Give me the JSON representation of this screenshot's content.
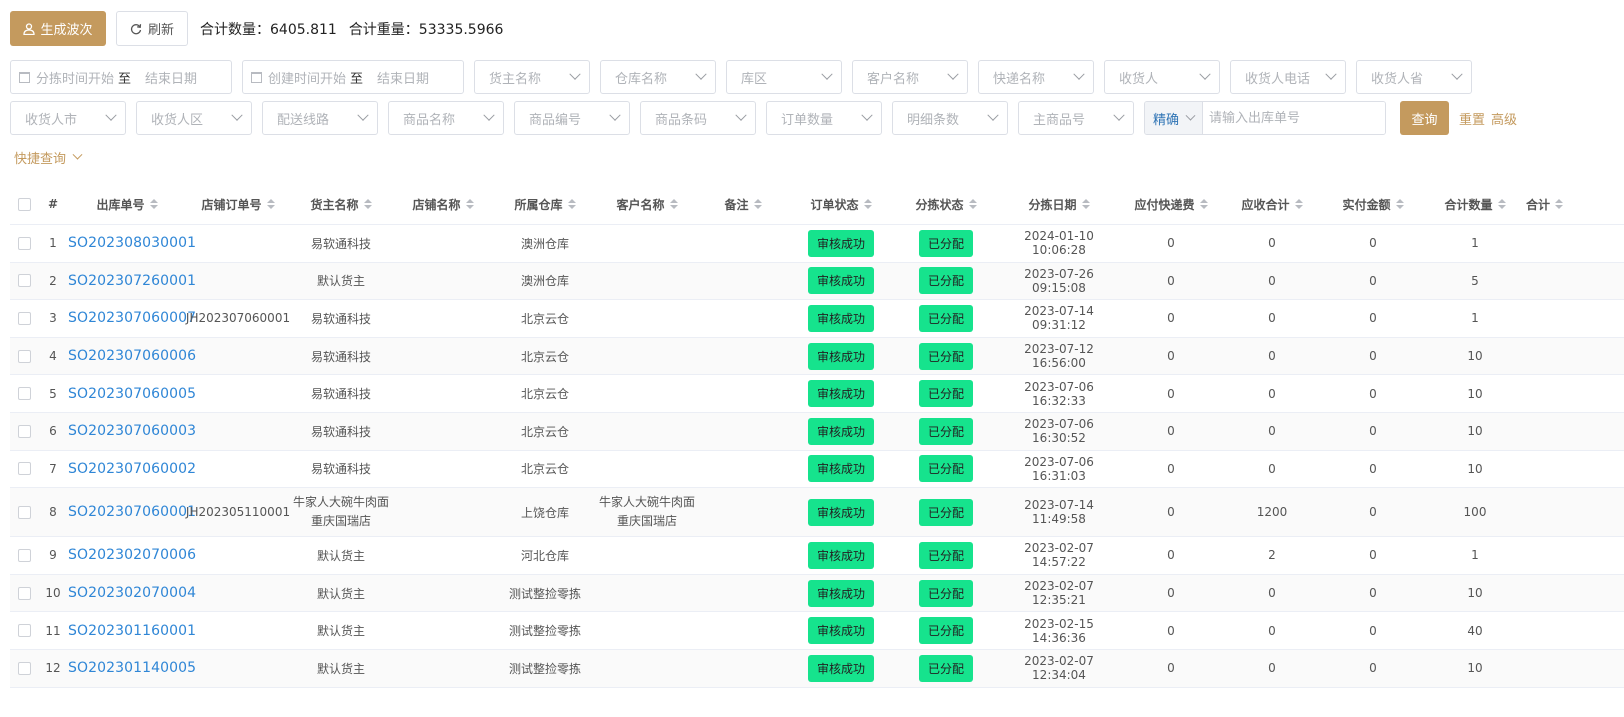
{
  "toolbar": {
    "generate_label": "生成波次",
    "refresh_label": "刷新",
    "total_qty": "合计数量：6405.811",
    "total_weight": "合计重量：53335.5966"
  },
  "filters": {
    "sort_time": {
      "start": "分拣时间开始",
      "sep": "至",
      "end": "结束日期"
    },
    "create_time": {
      "start": "创建时间开始",
      "sep": "至",
      "end": "结束日期"
    },
    "row1": [
      "货主名称",
      "仓库名称",
      "库区",
      "客户名称",
      "快递名称",
      "收货人",
      "收货人电话",
      "收货人省"
    ],
    "row2": [
      "收货人市",
      "收货人区",
      "配送线路",
      "商品名称",
      "商品编号",
      "商品条码",
      "订单数量",
      "明细条数",
      "主商品号"
    ],
    "search_mode": "精确",
    "search_placeholder": "请输入出库单号",
    "query_label": "查询",
    "reset_label": "重置",
    "advanced_label": "高级",
    "quick_query_label": "快捷查询"
  },
  "table": {
    "headers": [
      "#",
      "出库单号",
      "店铺订单号",
      "货主名称",
      "店铺名称",
      "所属仓库",
      "客户名称",
      "备注",
      "订单状态",
      "分拣状态",
      "分拣日期",
      "应付快递费",
      "应收合计",
      "实付金额",
      "合计数量",
      "合计"
    ],
    "rows": [
      {
        "idx": "1",
        "so": "SO202308030001",
        "shop_order": "",
        "owner": "易软通科技",
        "shop": "",
        "warehouse": "澳洲仓库",
        "customer": "",
        "remark": "",
        "order_status": "审核成功",
        "sort_status": "已分配",
        "sort_date": "2024-01-10 10:06:28",
        "freight": "0",
        "receivable": "0",
        "paid": "0",
        "qty": "1"
      },
      {
        "idx": "2",
        "so": "SO202307260001",
        "shop_order": "",
        "owner": "默认货主",
        "shop": "",
        "warehouse": "澳洲仓库",
        "customer": "",
        "remark": "",
        "order_status": "审核成功",
        "sort_status": "已分配",
        "sort_date": "2023-07-26 09:15:08",
        "freight": "0",
        "receivable": "0",
        "paid": "0",
        "qty": "5"
      },
      {
        "idx": "3",
        "so": "SO202307060007",
        "shop_order": "JH202307060001",
        "owner": "易软通科技",
        "shop": "",
        "warehouse": "北京云仓",
        "customer": "",
        "remark": "",
        "order_status": "审核成功",
        "sort_status": "已分配",
        "sort_date": "2023-07-14 09:31:12",
        "freight": "0",
        "receivable": "0",
        "paid": "0",
        "qty": "1"
      },
      {
        "idx": "4",
        "so": "SO202307060006",
        "shop_order": "",
        "owner": "易软通科技",
        "shop": "",
        "warehouse": "北京云仓",
        "customer": "",
        "remark": "",
        "order_status": "审核成功",
        "sort_status": "已分配",
        "sort_date": "2023-07-12 16:56:00",
        "freight": "0",
        "receivable": "0",
        "paid": "0",
        "qty": "10"
      },
      {
        "idx": "5",
        "so": "SO202307060005",
        "shop_order": "",
        "owner": "易软通科技",
        "shop": "",
        "warehouse": "北京云仓",
        "customer": "",
        "remark": "",
        "order_status": "审核成功",
        "sort_status": "已分配",
        "sort_date": "2023-07-06 16:32:33",
        "freight": "0",
        "receivable": "0",
        "paid": "0",
        "qty": "10"
      },
      {
        "idx": "6",
        "so": "SO202307060003",
        "shop_order": "",
        "owner": "易软通科技",
        "shop": "",
        "warehouse": "北京云仓",
        "customer": "",
        "remark": "",
        "order_status": "审核成功",
        "sort_status": "已分配",
        "sort_date": "2023-07-06 16:30:52",
        "freight": "0",
        "receivable": "0",
        "paid": "0",
        "qty": "10"
      },
      {
        "idx": "7",
        "so": "SO202307060002",
        "shop_order": "",
        "owner": "易软通科技",
        "shop": "",
        "warehouse": "北京云仓",
        "customer": "",
        "remark": "",
        "order_status": "审核成功",
        "sort_status": "已分配",
        "sort_date": "2023-07-06 16:31:03",
        "freight": "0",
        "receivable": "0",
        "paid": "0",
        "qty": "10"
      },
      {
        "idx": "8",
        "so": "SO202307060001",
        "shop_order": "JH202305110001",
        "owner": "牛家人大碗牛肉面\n重庆国瑞店",
        "shop": "",
        "warehouse": "上饶仓库",
        "customer": "牛家人大碗牛肉面\n重庆国瑞店",
        "remark": "",
        "order_status": "审核成功",
        "sort_status": "已分配",
        "sort_date": "2023-07-14 11:49:58",
        "freight": "0",
        "receivable": "1200",
        "paid": "0",
        "qty": "100"
      },
      {
        "idx": "9",
        "so": "SO202302070006",
        "shop_order": "",
        "owner": "默认货主",
        "shop": "",
        "warehouse": "河北仓库",
        "customer": "",
        "remark": "",
        "order_status": "审核成功",
        "sort_status": "已分配",
        "sort_date": "2023-02-07 14:57:22",
        "freight": "0",
        "receivable": "2",
        "paid": "0",
        "qty": "1"
      },
      {
        "idx": "10",
        "so": "SO202302070004",
        "shop_order": "",
        "owner": "默认货主",
        "shop": "",
        "warehouse": "测试整捡零拣",
        "customer": "",
        "remark": "",
        "order_status": "审核成功",
        "sort_status": "已分配",
        "sort_date": "2023-02-07 12:35:21",
        "freight": "0",
        "receivable": "0",
        "paid": "0",
        "qty": "10"
      },
      {
        "idx": "11",
        "so": "SO202301160001",
        "shop_order": "",
        "owner": "默认货主",
        "shop": "",
        "warehouse": "测试整捡零拣",
        "customer": "",
        "remark": "",
        "order_status": "审核成功",
        "sort_status": "已分配",
        "sort_date": "2023-02-15 14:36:36",
        "freight": "0",
        "receivable": "0",
        "paid": "0",
        "qty": "40"
      },
      {
        "idx": "12",
        "so": "SO202301140005",
        "shop_order": "",
        "owner": "默认货主",
        "shop": "",
        "warehouse": "测试整捡零拣",
        "customer": "",
        "remark": "",
        "order_status": "审核成功",
        "sort_status": "已分配",
        "sort_date": "2023-02-07 12:34:04",
        "freight": "0",
        "receivable": "0",
        "paid": "0",
        "qty": "10"
      }
    ]
  },
  "colors": {
    "accent": "#c49a5e",
    "link": "#2f86d6",
    "status_tag": "#16e38d"
  }
}
